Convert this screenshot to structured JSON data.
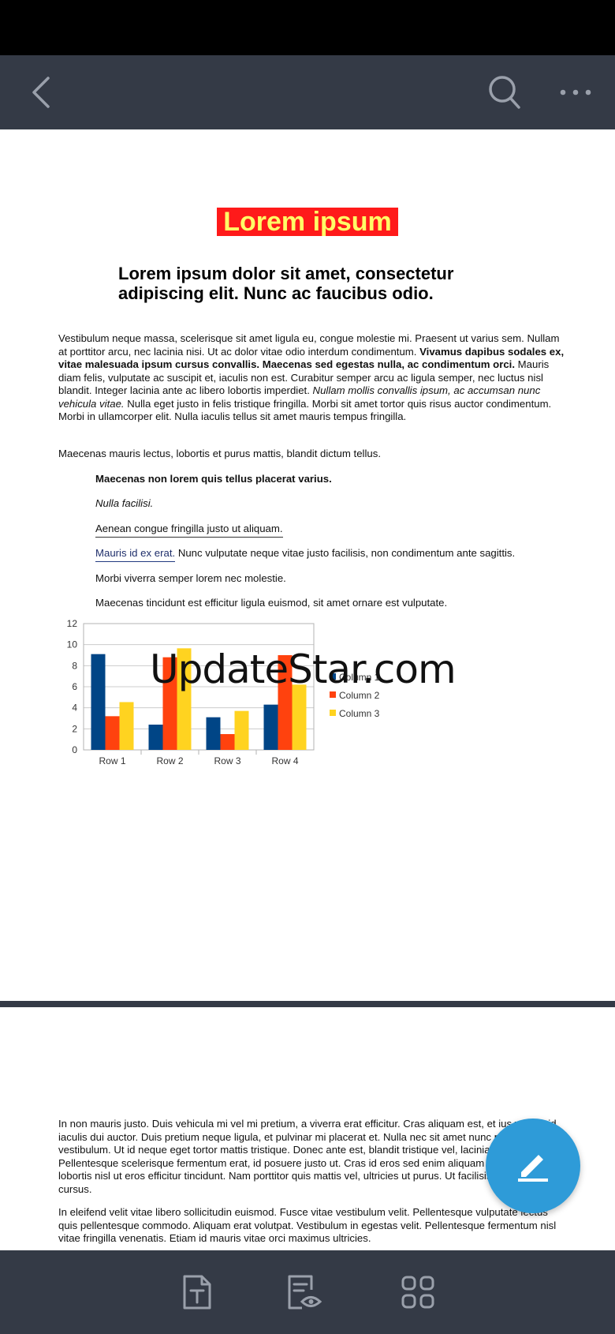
{
  "toolbar": {
    "back_icon": "chevron-left-icon",
    "search_icon": "search-icon",
    "more_icon": "more-horizontal-icon"
  },
  "document": {
    "title": "Lorem ipsum",
    "subtitle": "Lorem ipsum dolor sit amet, consectetur adipiscing elit. Nunc ac faucibus odio.",
    "p1_a": "Vestibulum neque massa, scelerisque sit amet ligula eu, congue molestie mi. Praesent ut varius sem. Nullam at porttitor arcu, nec lacinia nisi. Ut ac dolor vitae odio interdum condimentum. ",
    "p1_bold": "Vivamus dapibus sodales ex, vitae malesuada ipsum cursus convallis. Maecenas sed egestas nulla, ac condimentum orci.",
    "p1_b": " Mauris diam felis, vulputate ac suscipit et, iaculis non est. Curabitur semper arcu ac ligula semper, nec luctus nisl blandit. Integer lacinia ante ac libero lobortis imperdiet. ",
    "p1_italic": "Nullam mollis convallis ipsum, ac accumsan nunc vehicula vitae.",
    "p1_c": " Nulla eget justo in felis tristique fringilla. Morbi sit amet tortor quis risus auctor condimentum. Morbi in ullamcorper elit. Nulla iaculis tellus sit amet mauris tempus fringilla.",
    "p2": "Maecenas mauris lectus, lobortis et purus mattis, blandit dictum tellus.",
    "item1": "Maecenas non lorem quis tellus placerat varius.",
    "item2": "Nulla facilisi.",
    "item3": "Aenean congue fringilla justo ut aliquam.",
    "item4_link": "Mauris id ex erat.",
    "item4_rest": " Nunc vulputate neque vitae justo facilisis, non condimentum ante sagittis.",
    "item5": "Morbi viverra semper lorem nec molestie.",
    "item6": "Maecenas tincidunt est efficitur ligula euismod, sit amet ornare est vulputate.",
    "page2_p1": "In non mauris justo. Duis vehicula mi vel mi pretium, a viverra erat efficitur. Cras aliquam est, et ius varius, id iaculis dui auctor. Duis pretium neque ligula, et pulvinar mi placerat et. Nulla nec sit amet nunc posuere vestibulum. Ut id neque eget tortor mattis tristique. Donec ante est, blandit tristique vel, lacinia pulvinar arcu. Pellentesque scelerisque fermentum erat, id posuere justo ut. Cras id eros sed enim aliquam lobortis. Sed lobortis nisl ut eros efficitur tincidunt. Nam porttitor quis mattis vel, ultricies ut purus. Ut facilisis et lacus eu cursus.",
    "page2_p2": "In eleifend velit vitae libero sollicitudin euismod. Fusce vitae vestibulum velit. Pellentesque vulputate lectus quis pellentesque commodo. Aliquam erat volutpat. Vestibulum in egestas velit. Pellentesque fermentum nisl vitae fringilla venenatis. Etiam id mauris vitae orci maximus ultricies."
  },
  "watermark": "UpdateStar.com",
  "chart_data": {
    "type": "bar",
    "categories": [
      "Row 1",
      "Row 2",
      "Row 3",
      "Row 4"
    ],
    "series": [
      {
        "name": "Column 1",
        "color": "#004586",
        "values": [
          9.1,
          2.4,
          3.1,
          4.3
        ]
      },
      {
        "name": "Column 2",
        "color": "#ff420e",
        "values": [
          3.2,
          8.8,
          1.5,
          9.0
        ]
      },
      {
        "name": "Column 3",
        "color": "#ffd320",
        "values": [
          4.54,
          9.65,
          3.7,
          6.2
        ]
      }
    ],
    "ylim": [
      0,
      12
    ],
    "yticks": [
      "0",
      "2",
      "4",
      "6",
      "8",
      "10",
      "12"
    ],
    "legend": "right",
    "grid": true
  },
  "bottom_bar": {
    "icons": [
      "text-format-icon",
      "reading-mode-icon",
      "grid-apps-icon"
    ]
  },
  "fab": {
    "icon": "edit-pencil-icon"
  }
}
